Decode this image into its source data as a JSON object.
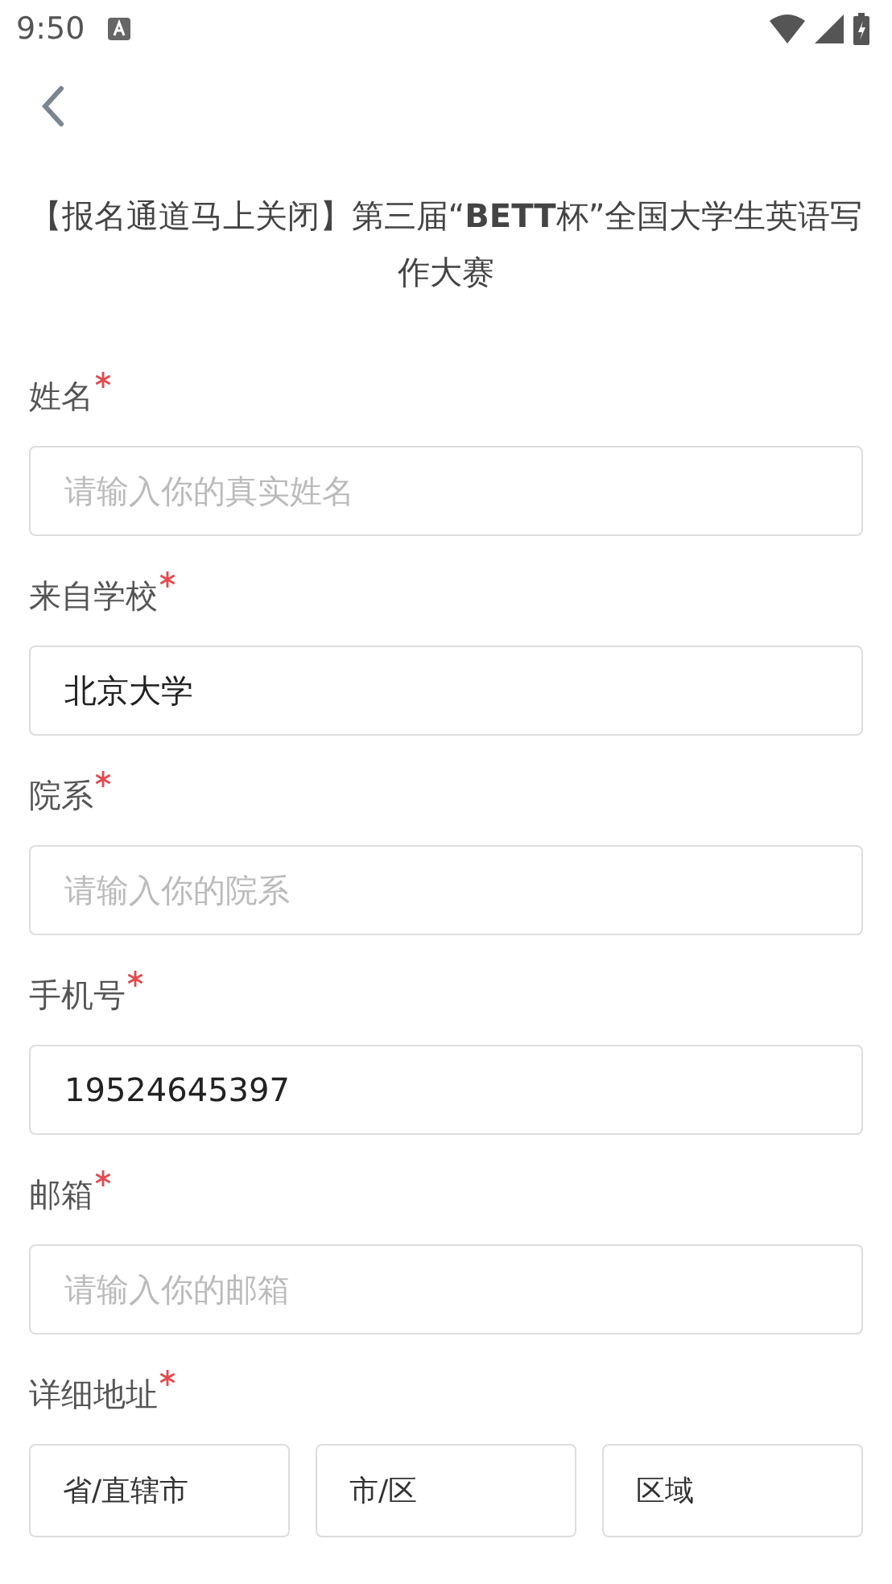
{
  "status_bar": {
    "time": "9:50"
  },
  "title": "【报名通道马上关闭】第三届“**BETT**杯”全国大学生英语写作大赛",
  "fields": [
    {
      "label": "姓名",
      "required": true,
      "placeholder": "请输入你的真实姓名"
    },
    {
      "label": "来自学校",
      "required": true,
      "value": "北京大学"
    },
    {
      "label": "院系",
      "required": true,
      "placeholder": "请输入你的院系"
    },
    {
      "label": "手机号",
      "required": true,
      "value": "19524645397"
    },
    {
      "label": "邮箱",
      "required": true,
      "placeholder": "请输入你的邮箱"
    }
  ],
  "address": {
    "label": "详细地址",
    "required": true,
    "selects": [
      {
        "placeholder": "省/直辖市"
      },
      {
        "placeholder": "市/区"
      },
      {
        "placeholder": "区域"
      }
    ]
  }
}
